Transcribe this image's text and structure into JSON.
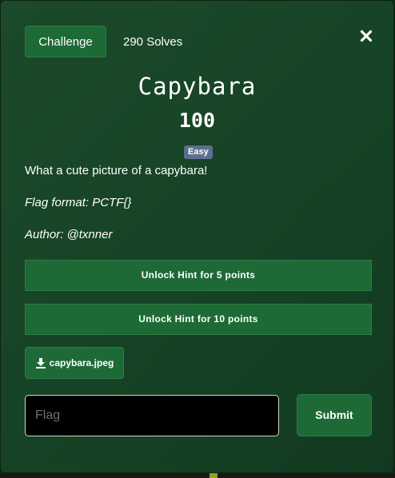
{
  "modal": {
    "tabs": {
      "challenge_label": "Challenge",
      "solves_label": "290 Solves"
    },
    "close_icon": "close-icon",
    "challenge": {
      "name": "Capybara",
      "value": "100",
      "difficulty": "Easy",
      "description": "What a cute picture of a capybara!",
      "flag_format": "Flag format: PCTF{}",
      "author": "Author: @txnner"
    },
    "hints": [
      {
        "label": "Unlock Hint for 5 points"
      },
      {
        "label": "Unlock Hint for 10 points"
      }
    ],
    "files": [
      {
        "name": "capybara.jpeg",
        "icon": "download-icon"
      }
    ],
    "flag_form": {
      "placeholder": "Flag",
      "value": "",
      "submit_label": "Submit"
    }
  },
  "colors": {
    "modal_background": "#174426",
    "button_green": "#1e6a36",
    "badge_slate": "#5c6f8f",
    "input_background": "#000000"
  }
}
